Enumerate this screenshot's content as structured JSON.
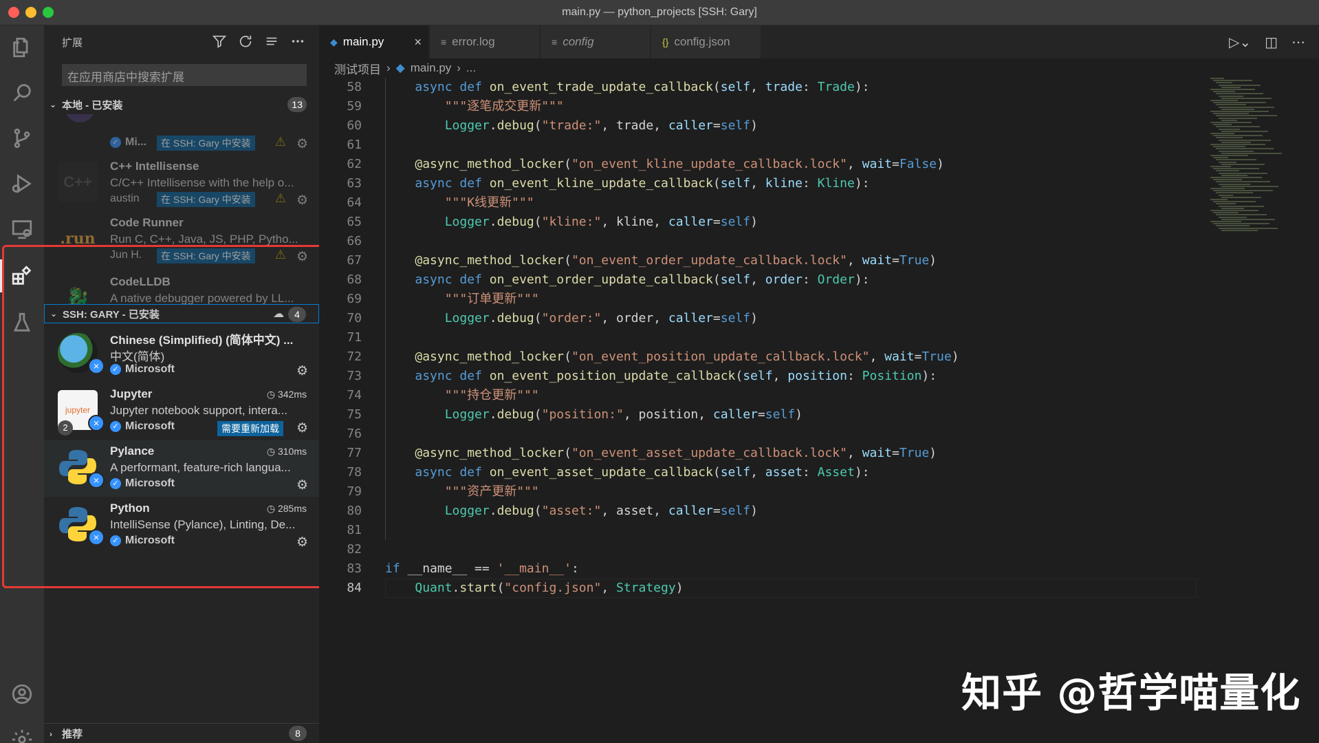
{
  "window": {
    "title": "main.py — python_projects [SSH: Gary]"
  },
  "sidebar": {
    "header": "扩展",
    "search_placeholder": "在应用商店中搜索扩展",
    "local_section": {
      "label": "本地 - 已安装",
      "count": "13"
    },
    "ssh_section": {
      "label": "SSH: GARY - 已安装",
      "count": "4"
    },
    "recommended_section": {
      "label": "推荐",
      "count": "8"
    },
    "local_extensions": [
      {
        "name": "",
        "description": "",
        "publisher": "Mi...",
        "badge": "在 SSH: Gary 中安装"
      },
      {
        "name": "C++ Intellisense",
        "description": "C/C++ Intellisense with the help o...",
        "publisher": "austin",
        "badge": "在 SSH: Gary 中安装",
        "icon_text": "C++"
      },
      {
        "name": "Code Runner",
        "description": "Run C, C++, Java, JS, PHP, Pytho...",
        "publisher": "Jun H.",
        "badge": "在 SSH: Gary 中安装",
        "icon_text": ".run"
      },
      {
        "name": "CodeLLDB",
        "description": "A native debugger powered by LL..."
      }
    ],
    "ssh_extensions": [
      {
        "name": "Chinese (Simplified) (简体中文) ...",
        "description": "中文(简体)",
        "publisher": "Microsoft"
      },
      {
        "name": "Jupyter",
        "description": "Jupyter notebook support, intera...",
        "publisher": "Microsoft",
        "timing": "342ms",
        "action": "需要重新加载",
        "sub_count": "2",
        "icon_text": "jupyter"
      },
      {
        "name": "Pylance",
        "description": "A performant, feature-rich langua...",
        "publisher": "Microsoft",
        "timing": "310ms"
      },
      {
        "name": "Python",
        "description": "IntelliSense (Pylance), Linting, De...",
        "publisher": "Microsoft",
        "timing": "285ms"
      }
    ]
  },
  "editor": {
    "tabs": [
      {
        "label": "main.py",
        "active": true
      },
      {
        "label": "error.log"
      },
      {
        "label": "config"
      },
      {
        "label": "config.json"
      }
    ],
    "breadcrumb": [
      "测试项目",
      "main.py",
      "..."
    ],
    "lines": [
      {
        "n": "58",
        "html": "    <span class='k'>async</span> <span class='k'>def</span> <span class='f'>on_event_trade_update_callback</span>(<span class='p'>self</span>, <span class='p'>trade</span>: <span class='c'>Trade</span>):"
      },
      {
        "n": "59",
        "html": "        <span class='s'>\"\"\"逐笔成交更新\"\"\"</span>"
      },
      {
        "n": "60",
        "html": "        <span class='c'>Logger</span>.<span class='f'>debug</span>(<span class='s'>\"trade:\"</span>, trade, <span class='p'>caller</span>=<span class='k'>self</span>)"
      },
      {
        "n": "61",
        "html": ""
      },
      {
        "n": "62",
        "html": "    <span class='f'>@async_method_locker</span>(<span class='s'>\"on_event_kline_update_callback.lock\"</span>, <span class='p'>wait</span>=<span class='k'>False</span>)"
      },
      {
        "n": "63",
        "html": "    <span class='k'>async</span> <span class='k'>def</span> <span class='f'>on_event_kline_update_callback</span>(<span class='p'>self</span>, <span class='p'>kline</span>: <span class='c'>Kline</span>):"
      },
      {
        "n": "64",
        "html": "        <span class='s'>\"\"\"K线更新\"\"\"</span>"
      },
      {
        "n": "65",
        "html": "        <span class='c'>Logger</span>.<span class='f'>debug</span>(<span class='s'>\"kline:\"</span>, kline, <span class='p'>caller</span>=<span class='k'>self</span>)"
      },
      {
        "n": "66",
        "html": ""
      },
      {
        "n": "67",
        "html": "    <span class='f'>@async_method_locker</span>(<span class='s'>\"on_event_order_update_callback.lock\"</span>, <span class='p'>wait</span>=<span class='k'>True</span>)"
      },
      {
        "n": "68",
        "html": "    <span class='k'>async</span> <span class='k'>def</span> <span class='f'>on_event_order_update_callback</span>(<span class='p'>self</span>, <span class='p'>order</span>: <span class='c'>Order</span>):"
      },
      {
        "n": "69",
        "html": "        <span class='s'>\"\"\"订单更新\"\"\"</span>"
      },
      {
        "n": "70",
        "html": "        <span class='c'>Logger</span>.<span class='f'>debug</span>(<span class='s'>\"order:\"</span>, order, <span class='p'>caller</span>=<span class='k'>self</span>)"
      },
      {
        "n": "71",
        "html": ""
      },
      {
        "n": "72",
        "html": "    <span class='f'>@async_method_locker</span>(<span class='s'>\"on_event_position_update_callback.lock\"</span>, <span class='p'>wait</span>=<span class='k'>True</span>)"
      },
      {
        "n": "73",
        "html": "    <span class='k'>async</span> <span class='k'>def</span> <span class='f'>on_event_position_update_callback</span>(<span class='p'>self</span>, <span class='p'>position</span>: <span class='c'>Position</span>):"
      },
      {
        "n": "74",
        "html": "        <span class='s'>\"\"\"持仓更新\"\"\"</span>"
      },
      {
        "n": "75",
        "html": "        <span class='c'>Logger</span>.<span class='f'>debug</span>(<span class='s'>\"position:\"</span>, position, <span class='p'>caller</span>=<span class='k'>self</span>)"
      },
      {
        "n": "76",
        "html": ""
      },
      {
        "n": "77",
        "html": "    <span class='f'>@async_method_locker</span>(<span class='s'>\"on_event_asset_update_callback.lock\"</span>, <span class='p'>wait</span>=<span class='k'>True</span>)"
      },
      {
        "n": "78",
        "html": "    <span class='k'>async</span> <span class='k'>def</span> <span class='f'>on_event_asset_update_callback</span>(<span class='p'>self</span>, <span class='p'>asset</span>: <span class='c'>Asset</span>):"
      },
      {
        "n": "79",
        "html": "        <span class='s'>\"\"\"资产更新\"\"\"</span>"
      },
      {
        "n": "80",
        "html": "        <span class='c'>Logger</span>.<span class='f'>debug</span>(<span class='s'>\"asset:\"</span>, asset, <span class='p'>caller</span>=<span class='k'>self</span>)"
      },
      {
        "n": "81",
        "html": ""
      },
      {
        "n": "82",
        "html": ""
      },
      {
        "n": "83",
        "html": "<span class='k'>if</span> __name__ == <span class='s'>'__main__'</span>:"
      },
      {
        "n": "84",
        "html": "    <span class='c'>Quant</span>.<span class='f'>start</span>(<span class='s'>\"config.json\"</span>, <span class='c'>Strategy</span>)"
      }
    ],
    "current_line": "84"
  },
  "watermark": "知乎 @哲学喵量化",
  "colors": {
    "accent": "#0e639c",
    "highlight_box": "#e53935",
    "verified": "#3794ff",
    "warning": "#cca700"
  }
}
